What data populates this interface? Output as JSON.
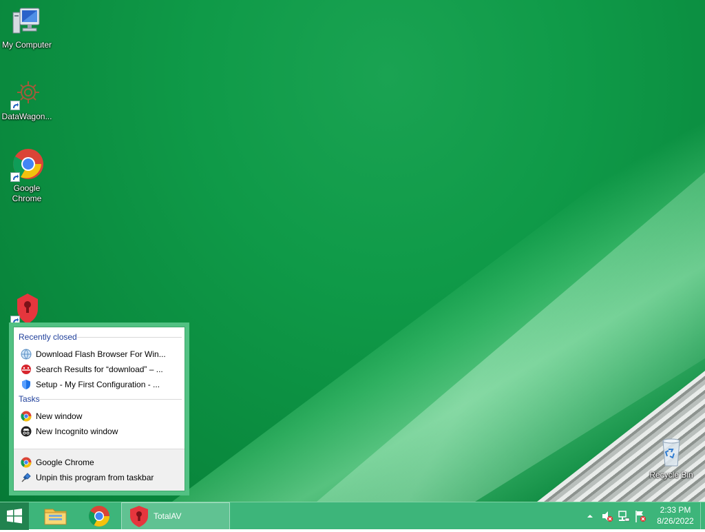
{
  "desktop": {
    "icons": [
      {
        "name": "my-computer",
        "label": "My Computer"
      },
      {
        "name": "datawagon",
        "label": "DataWagon..."
      },
      {
        "name": "google-chrome",
        "label": "Google Chrome"
      },
      {
        "name": "totalav",
        "label": ""
      },
      {
        "name": "recycle-bin",
        "label": "Recycle Bin"
      }
    ]
  },
  "jumplist": {
    "recently_closed_header": "Recently closed",
    "recent": [
      {
        "label": "Download Flash Browser For Win...",
        "icon": "globe-icon"
      },
      {
        "label": "Search Results for “download” – ...",
        "icon": "red-ladybug-icon"
      },
      {
        "label": "Setup - My First Configuration - ...",
        "icon": "blue-shield-icon"
      }
    ],
    "tasks_header": "Tasks",
    "tasks": [
      {
        "label": "New window",
        "icon": "chrome-icon"
      },
      {
        "label": "New Incognito window",
        "icon": "incognito-icon"
      }
    ],
    "footer": [
      {
        "label": "Google Chrome",
        "icon": "chrome-icon"
      },
      {
        "label": "Unpin this program from taskbar",
        "icon": "unpin-icon"
      }
    ]
  },
  "taskbar": {
    "active_app_label": "TotalAV",
    "clock_time": "2:33 PM",
    "clock_date": "8/26/2022",
    "color": "#3db57a"
  }
}
